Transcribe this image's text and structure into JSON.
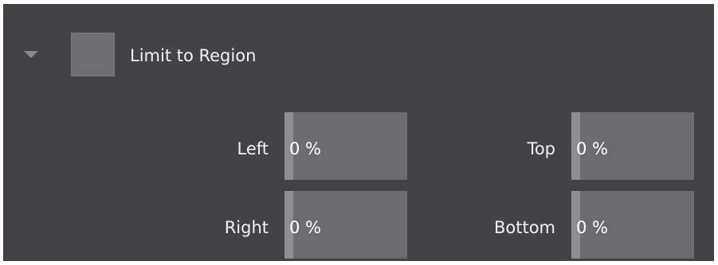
{
  "section": {
    "title": "Limit to Region",
    "enabled": false
  },
  "fields": {
    "left": {
      "label": "Left",
      "value": "0 %",
      "fraction": 0
    },
    "top": {
      "label": "Top",
      "value": "0 %",
      "fraction": 0
    },
    "right": {
      "label": "Right",
      "value": "0 %",
      "fraction": 0
    },
    "bottom": {
      "label": "Bottom",
      "value": "0 %",
      "fraction": 0
    }
  },
  "colors": {
    "panel_background": "#434347",
    "field_background": "#6c6c70",
    "field_fill": "#8e8e92",
    "text": "#f2f2f2"
  },
  "icons": {
    "collapse": "triangle-down-icon"
  }
}
